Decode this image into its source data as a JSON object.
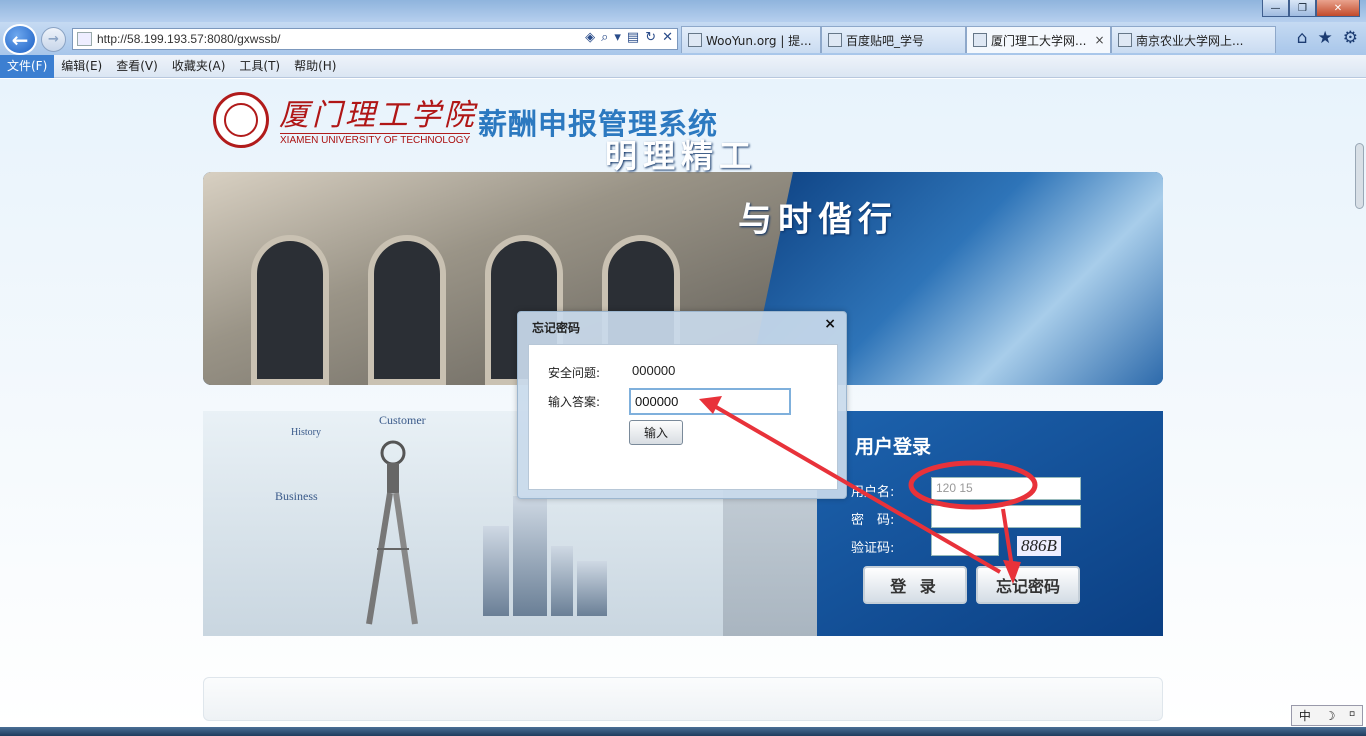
{
  "browser": {
    "url": "http://58.199.193.57:8080/gxwssb/",
    "tabs": [
      {
        "label": "WooYun.org | 提...",
        "active": false
      },
      {
        "label": "百度贴吧_学号",
        "active": false
      },
      {
        "label": "厦门理工大学网...",
        "active": true
      },
      {
        "label": "南京农业大学网上...",
        "active": false
      }
    ],
    "tab_close": "×",
    "menu": [
      "文件(F)",
      "编辑(E)",
      "查看(V)",
      "收藏夹(A)",
      "工具(T)",
      "帮助(H)"
    ],
    "window_buttons": {
      "minimize": "—",
      "maximize": "❐",
      "close": "✕"
    },
    "nav_icons": {
      "home": "⌂",
      "favorites": "★",
      "tools": "⚙"
    },
    "addr_icons": {
      "shield": "◈",
      "search": "⌕",
      "dropdown": "▾",
      "compat": "▤",
      "refresh": "↻",
      "stop": "✕"
    }
  },
  "page": {
    "logo_cn": "厦门理工学院",
    "logo_en": "XIAMEN UNIVERSITY OF TECHNOLOGY",
    "system_title": "薪酬申报管理系统",
    "slogan_1": "明理精工",
    "slogan_2": "与时偕行",
    "decor_labels": {
      "history": "History",
      "customer": "Customer",
      "business": "Business"
    },
    "login": {
      "title": "用户登录",
      "username_label": "用户名:",
      "username_value": "120      15",
      "password_label": "密　码:",
      "password_value": "",
      "captcha_label": "验证码:",
      "captcha_value": "",
      "captcha_image_text": "886B",
      "login_button": "登 录",
      "forgot_button": "忘记密码"
    }
  },
  "dialog": {
    "title": "忘记密码",
    "close": "×",
    "question_label": "安全问题:",
    "question_value": "000000",
    "answer_label": "输入答案:",
    "answer_value": "000000",
    "submit_button": "输入"
  },
  "ime": {
    "mode": "中",
    "moon": "☽",
    "punct": "⸋"
  },
  "colors": {
    "accent_blue": "#2c79c0",
    "annotation_red": "#e8323a",
    "seal_red": "#b01616"
  }
}
